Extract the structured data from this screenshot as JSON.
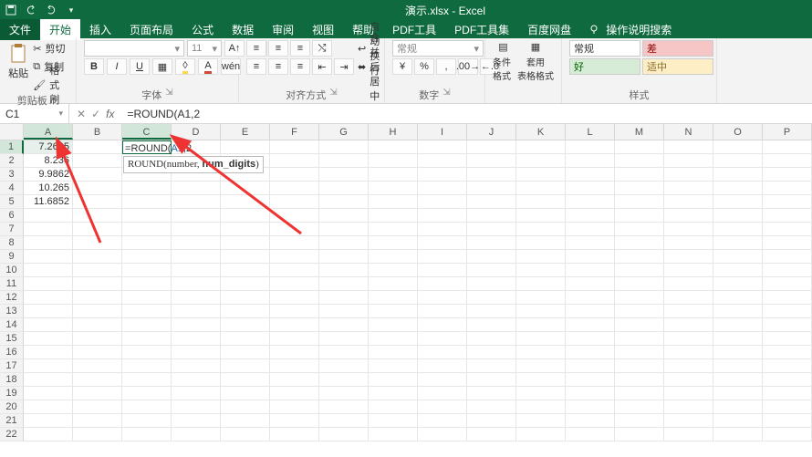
{
  "title": "演示.xlsx - Excel",
  "qat": {
    "save": "save-icon",
    "undo": "undo-icon",
    "redo": "redo-icon",
    "more": "more-icon"
  },
  "tabs": [
    "文件",
    "开始",
    "插入",
    "页面布局",
    "公式",
    "数据",
    "审阅",
    "视图",
    "帮助",
    "PDF工具",
    "PDF工具集",
    "百度网盘"
  ],
  "tell_me_placeholder": "操作说明搜索",
  "ribbon": {
    "clipboard": {
      "paste": "粘贴",
      "cut": "剪切",
      "copy": "复制",
      "format_painter": "格式刷",
      "label": "剪贴板"
    },
    "font": {
      "family": "",
      "size": "11",
      "label": "字体",
      "buttons": [
        "B",
        "I",
        "U"
      ]
    },
    "alignment": {
      "wrap": "自动换行",
      "merge": "合并后居中",
      "label": "对齐方式"
    },
    "number": {
      "format": "常规",
      "label": "数字"
    },
    "styles_cmd": {
      "cond": "条件格式",
      "table": "套用\n表格格式",
      "label": ""
    },
    "styles": {
      "normal": "常规",
      "bad": "差",
      "good": "好",
      "neutral": "适中",
      "label": "样式"
    }
  },
  "namebox": "C1",
  "formula": "=ROUND(A1,2",
  "cell_edit": {
    "eq": "=",
    "fn": "ROUND",
    "open": "(",
    "ref": "A1",
    "rest": ",2"
  },
  "tooltip": {
    "prefix": "ROUND(number, ",
    "bold": "num_digits",
    "suffix": ")"
  },
  "columns": [
    "A",
    "B",
    "C",
    "D",
    "E",
    "F",
    "G",
    "H",
    "I",
    "J",
    "K",
    "L",
    "M",
    "N",
    "O",
    "P"
  ],
  "rows": [
    {
      "n": "1",
      "A": "7.2635"
    },
    {
      "n": "2",
      "A": "8.236"
    },
    {
      "n": "3",
      "A": "9.9862"
    },
    {
      "n": "4",
      "A": "10.265"
    },
    {
      "n": "5",
      "A": "11.6852"
    },
    {
      "n": "6",
      "A": ""
    },
    {
      "n": "7",
      "A": ""
    },
    {
      "n": "8",
      "A": ""
    },
    {
      "n": "9",
      "A": ""
    },
    {
      "n": "10",
      "A": ""
    },
    {
      "n": "11",
      "A": ""
    },
    {
      "n": "12",
      "A": ""
    },
    {
      "n": "13",
      "A": ""
    },
    {
      "n": "14",
      "A": ""
    },
    {
      "n": "15",
      "A": ""
    },
    {
      "n": "16",
      "A": ""
    },
    {
      "n": "17",
      "A": ""
    },
    {
      "n": "18",
      "A": ""
    },
    {
      "n": "19",
      "A": ""
    },
    {
      "n": "20",
      "A": ""
    },
    {
      "n": "21",
      "A": ""
    },
    {
      "n": "22",
      "A": ""
    }
  ]
}
